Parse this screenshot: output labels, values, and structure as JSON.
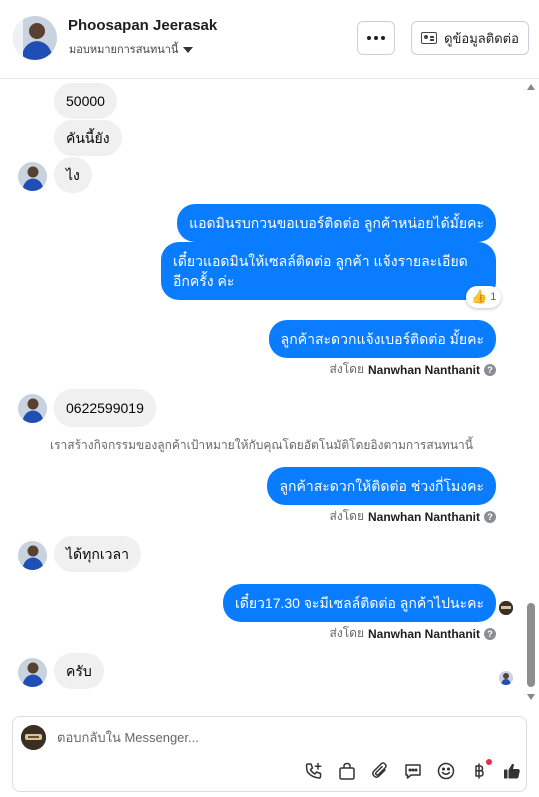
{
  "header": {
    "contact_name": "Phoosapan Jeerasak",
    "assign_label": "มอบหมายการสนทนานี้",
    "more_label": "···",
    "view_contact_label": "ดูข้อมูลติดต่อ"
  },
  "messages": {
    "in_1": "50000",
    "in_2": "คันนี้ยัง",
    "in_3": "ไง",
    "out_1": "แอดมินรบกวนขอเบอร์ติดต่อ ลูกค้าหน่อยได้มั้ยคะ",
    "out_2": "เดี๋ยวแอดมินให้เซลล์ติดต่อ ลูกค้า แจ้งรายละเอียดอีกครั้ง ค่ะ",
    "out_2_reaction_count": "1",
    "out_3": "ลูกค้าสะดวกแจ้งเบอร์ติดต่อ มั้ยคะ",
    "sent_by_prefix": "ส่งโดย",
    "sent_by_name": "Nanwhan Nanthanit",
    "in_4": "0622599019",
    "system_note": "เราสร้างกิจกรรมของลูกค้าเป้าหมายให้กับคุณโดยอัตโนมัติโดยอิงตามการสนทนานี้",
    "out_4": "ลูกค้าสะดวกให้ติดต่อ ช่วงกี่โมงคะ",
    "in_5": "ได้ทุกเวลา",
    "out_5": "เดี๋ยว17.30 จะมีเซลล์ติดต่อ ลูกค้าไปนะคะ",
    "in_6": "ครับ"
  },
  "composer": {
    "placeholder": "ตอบกลับใน Messenger..."
  },
  "icons": [
    "more-icon",
    "contact-card-icon",
    "chevron-down-icon",
    "thumbs-up-icon",
    "question-icon",
    "phone-plus-icon",
    "shopping-bag-icon",
    "paperclip-icon",
    "chat-bubble-icon",
    "emoji-icon",
    "baht-icon",
    "like-icon"
  ],
  "colors": {
    "outgoing_bubble": "#0a7cff",
    "incoming_bubble": "#f0f0f0",
    "notification_dot": "#f02849"
  }
}
